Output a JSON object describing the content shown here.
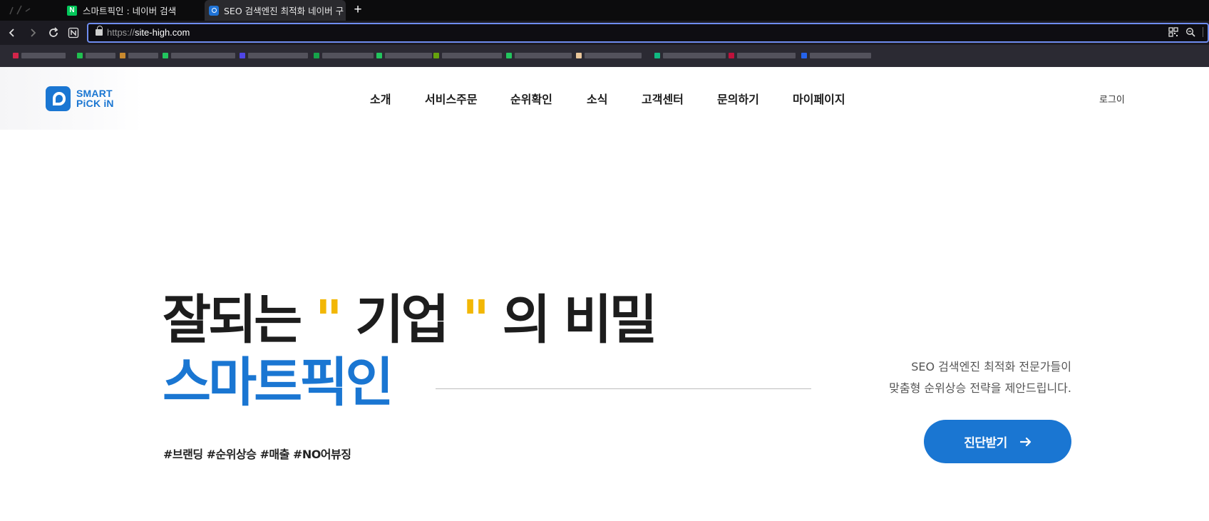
{
  "browser": {
    "tabs": [
      {
        "title": "스마트픽인 : 네이버 검색",
        "icon": "naver-favicon",
        "favicon_letter": "N"
      },
      {
        "title": "SEO 검색엔진 최적화 네이버 구",
        "icon": "smartpickin-favicon",
        "active": true
      }
    ],
    "new_tab_label": "+",
    "address": {
      "scheme": "https://",
      "host": "site-high.com"
    },
    "toolbar_icons": [
      "back-icon",
      "forward-icon",
      "reload-icon",
      "notion-icon"
    ],
    "url_actions": [
      "qr-code-icon",
      "zoom-icon"
    ]
  },
  "site": {
    "brand": {
      "line1": "SMART",
      "line2": "PiCK iN",
      "color": "#1a76d2"
    },
    "menu": [
      "소개",
      "서비스주문",
      "순위확인",
      "소식",
      "고객센터",
      "문의하기",
      "마이페이지"
    ],
    "login": "로그이",
    "hero": {
      "line1_a": "잘되는",
      "quote_open": "\"",
      "line1_b": "기업",
      "quote_close": "\"",
      "line1_c": "의 비밀",
      "line2": "스마트픽인",
      "subtitle_1": "SEO 검색엔진 최적화 전문가들이",
      "subtitle_2": "맞춤형 순위상승 전략을 제안드립니다.",
      "tags": "#브랜딩 #순위상승 #매출 #NO어뷰징",
      "cta_label": "진단받기",
      "cta_icon": "arrow-right-icon"
    },
    "colors": {
      "accent": "#1a76d2",
      "quote": "#f2b705",
      "text": "#1d1d1d"
    }
  }
}
